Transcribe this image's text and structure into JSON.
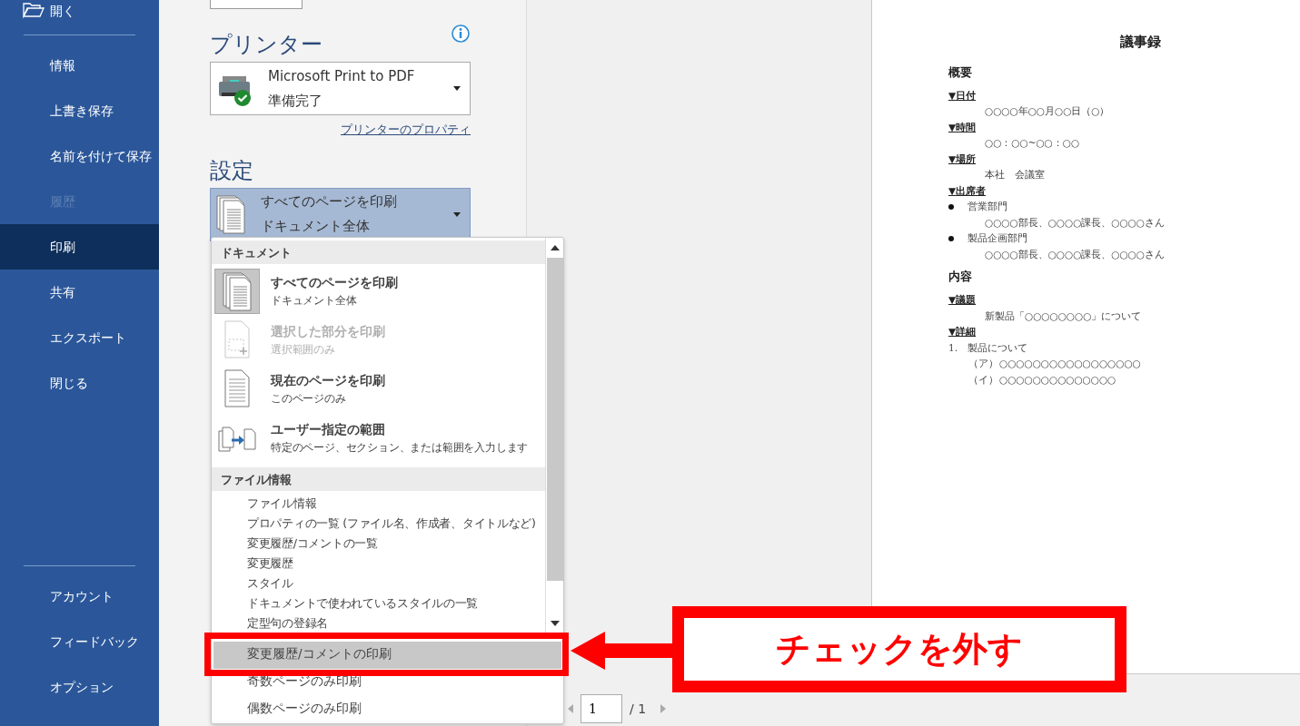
{
  "sidebar": {
    "items": [
      {
        "label": "開く",
        "kind": "open",
        "selected": false,
        "disabled": false
      },
      {
        "kind": "divider"
      },
      {
        "label": "情報",
        "kind": "plain",
        "selected": false,
        "disabled": false
      },
      {
        "label": "上書き保存",
        "kind": "plain",
        "selected": false,
        "disabled": false
      },
      {
        "label": "名前を付けて保存",
        "kind": "plain",
        "selected": false,
        "disabled": false
      },
      {
        "label": "履歴",
        "kind": "plain",
        "selected": false,
        "disabled": true
      },
      {
        "label": "印刷",
        "kind": "plain",
        "selected": true,
        "disabled": false
      },
      {
        "label": "共有",
        "kind": "plain",
        "selected": false,
        "disabled": false
      },
      {
        "label": "エクスポート",
        "kind": "plain",
        "selected": false,
        "disabled": false
      },
      {
        "label": "閉じる",
        "kind": "plain",
        "selected": false,
        "disabled": false
      },
      {
        "kind": "spacer"
      },
      {
        "kind": "divider"
      },
      {
        "label": "アカウント",
        "kind": "plain",
        "selected": false,
        "disabled": false
      },
      {
        "label": "フィードバック",
        "kind": "plain",
        "selected": false,
        "disabled": false
      },
      {
        "label": "オプション",
        "kind": "plain",
        "selected": false,
        "disabled": false
      }
    ]
  },
  "printer": {
    "heading": "プリンター",
    "name": "Microsoft Print to PDF",
    "status": "準備完了",
    "properties_link": "プリンターのプロパティ"
  },
  "settings": {
    "heading": "設定",
    "selected_title": "すべてのページを印刷",
    "selected_sub": "ドキュメント全体",
    "expanded": true
  },
  "menu": {
    "groups": [
      {
        "header": "ドキュメント",
        "items": [
          {
            "kind": "stack",
            "title": "すべてのページを印刷",
            "sub": "ドキュメント全体",
            "selected": true,
            "disabled": false
          },
          {
            "kind": "selection",
            "title": "選択した部分を印刷",
            "sub": "選択範囲のみ",
            "selected": false,
            "disabled": true
          },
          {
            "kind": "page",
            "title": "現在のページを印刷",
            "sub": "このページのみ",
            "selected": false,
            "disabled": false
          },
          {
            "kind": "range",
            "title": "ユーザー指定の範囲",
            "sub": "特定のページ、セクション、または範囲を入力します",
            "selected": false,
            "disabled": false
          }
        ]
      },
      {
        "header": "ファイル情報",
        "items": [
          {
            "kind": "plain",
            "title": "ファイル情報"
          },
          {
            "kind": "plain",
            "title": "プロパティの一覧 (ファイル名、作成者、タイトルなど)"
          },
          {
            "kind": "plain",
            "title": "変更履歴/コメントの一覧"
          },
          {
            "kind": "plain",
            "title": "変更履歴"
          },
          {
            "kind": "plain",
            "title": "スタイル"
          },
          {
            "kind": "plain",
            "title": "ドキュメントで使われているスタイルの一覧"
          },
          {
            "kind": "plain",
            "title": "定型句の登録名"
          }
        ]
      }
    ],
    "bottom_items": [
      {
        "title": "変更履歴/コメントの印刷",
        "highlighted": true
      },
      {
        "title": "奇数ページのみ印刷",
        "highlighted": false
      },
      {
        "title": "偶数ページのみ印刷",
        "highlighted": false
      }
    ]
  },
  "preview": {
    "document": {
      "title": "議事録",
      "blocks": [
        {
          "kind": "heading",
          "text": "概要"
        },
        {
          "kind": "label",
          "text": "▼日付"
        },
        {
          "kind": "indent",
          "text": "○○○○年○○月○○日（○）"
        },
        {
          "kind": "label",
          "text": "▼時間"
        },
        {
          "kind": "indent",
          "text": "○○：○○~○○：○○"
        },
        {
          "kind": "label",
          "text": "▼場所"
        },
        {
          "kind": "indent",
          "text": "本社　会議室"
        },
        {
          "kind": "label",
          "text": "▼出席者"
        },
        {
          "kind": "bullet",
          "text": "営業部門"
        },
        {
          "kind": "indent",
          "text": "○○○○部長、○○○○課長、○○○○さん"
        },
        {
          "kind": "bullet",
          "text": "製品企画部門"
        },
        {
          "kind": "indent",
          "text": "○○○○部長、○○○○課長、○○○○さん"
        },
        {
          "kind": "heading",
          "text": "内容"
        },
        {
          "kind": "label",
          "text": "▼議題"
        },
        {
          "kind": "indent",
          "text": "新製品「○○○○○○○○」について"
        },
        {
          "kind": "label",
          "text": "▼詳細"
        },
        {
          "kind": "numbered",
          "num": "1.",
          "text": "製品について"
        },
        {
          "kind": "sub",
          "num": "（ア）",
          "text": "○○○○○○○○○○○○○○○○○"
        },
        {
          "kind": "sub",
          "num": "（イ）",
          "text": "○○○○○○○○○○○○○○"
        }
      ]
    },
    "page_number": "1",
    "page_total": "/ 1"
  },
  "callout": {
    "text": "チェックを外す"
  }
}
